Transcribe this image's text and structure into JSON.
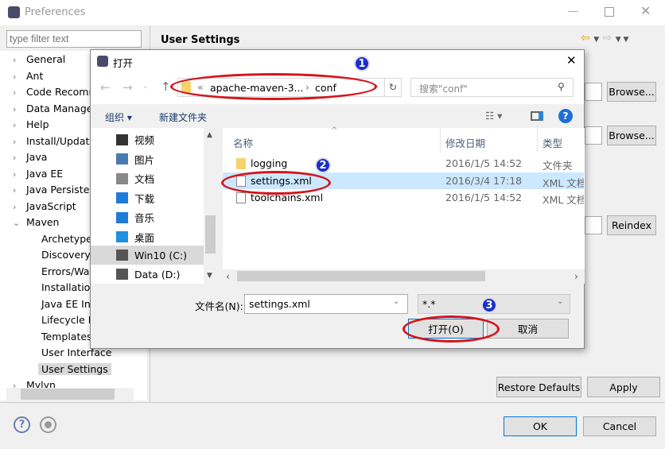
{
  "window": {
    "title": "Preferences"
  },
  "filter": {
    "placeholder": "type filter text"
  },
  "tree": {
    "items": [
      "General",
      "Ant",
      "Code Recomm",
      "Data Manage",
      "Help",
      "Install/Update",
      "Java",
      "Java EE",
      "Java Persister",
      "JavaScript",
      "Maven"
    ],
    "maven_children": [
      "Archetype",
      "Discovery",
      "Errors/Wa",
      "Installation",
      "Java EE In",
      "Lifecycle M",
      "Templates",
      "User Interface",
      "User Settings"
    ],
    "after": "Mylyn"
  },
  "page": {
    "title": "User Settings",
    "browse1": "Browse...",
    "browse2": "Browse...",
    "reindex": "Reindex",
    "restore_defaults": "Restore Defaults",
    "apply": "Apply",
    "ok": "OK",
    "cancel": "Cancel"
  },
  "dialog": {
    "title": "打开",
    "address": {
      "parent": "apache-maven-3...",
      "current": "conf"
    },
    "search_placeholder": "搜索\"conf\"",
    "toolbar": {
      "organize": "组织",
      "new_folder": "新建文件夹"
    },
    "nav": [
      "视频",
      "图片",
      "文档",
      "下载",
      "音乐",
      "桌面",
      "Win10 (C:)",
      "Data (D:)"
    ],
    "columns": {
      "name": "名称",
      "date": "修改日期",
      "type": "类型"
    },
    "files": [
      {
        "name": "logging",
        "date": "2016/1/5 14:52",
        "type": "文件夹"
      },
      {
        "name": "settings.xml",
        "date": "2016/3/4 17:18",
        "type": "XML 文档"
      },
      {
        "name": "toolchains.xml",
        "date": "2016/1/5 14:52",
        "type": "XML 文档"
      }
    ],
    "filename_label": "文件名(N):",
    "filename_value": "settings.xml",
    "filetype": "*.*",
    "open": "打开(O)",
    "cancel": "取消"
  },
  "annotations": [
    "1",
    "2",
    "3"
  ],
  "colors": {
    "annotation": "#d4141a",
    "badge": "#1a2fc8",
    "selection": "#cce8ff",
    "accent": "#0078d7"
  }
}
